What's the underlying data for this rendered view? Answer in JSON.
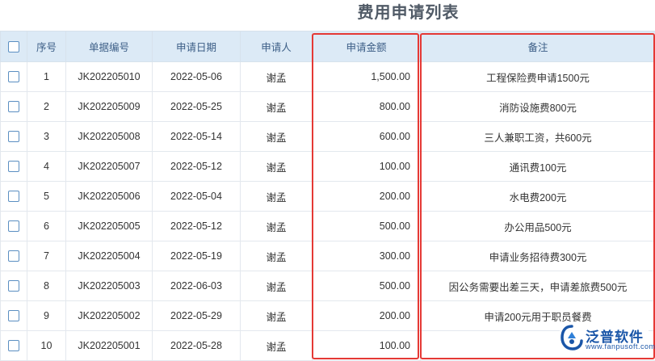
{
  "page": {
    "title": "费用申请列表"
  },
  "table": {
    "columns": [
      "序号",
      "单据编号",
      "申请日期",
      "申请人",
      "申请金额",
      "备注"
    ],
    "rows": [
      {
        "index": "1",
        "code": "JK202205010",
        "date": "2022-05-06",
        "applicant": "谢孟",
        "amount": "1,500.00",
        "remark": "工程保险费申请1500元"
      },
      {
        "index": "2",
        "code": "JK202205009",
        "date": "2022-05-25",
        "applicant": "谢孟",
        "amount": "800.00",
        "remark": "消防设施费800元"
      },
      {
        "index": "3",
        "code": "JK202205008",
        "date": "2022-05-14",
        "applicant": "谢孟",
        "amount": "600.00",
        "remark": "三人兼职工资，共600元"
      },
      {
        "index": "4",
        "code": "JK202205007",
        "date": "2022-05-12",
        "applicant": "谢孟",
        "amount": "100.00",
        "remark": "通讯费100元"
      },
      {
        "index": "5",
        "code": "JK202205006",
        "date": "2022-05-04",
        "applicant": "谢孟",
        "amount": "200.00",
        "remark": "水电费200元"
      },
      {
        "index": "6",
        "code": "JK202205005",
        "date": "2022-05-12",
        "applicant": "谢孟",
        "amount": "500.00",
        "remark": "办公用品500元"
      },
      {
        "index": "7",
        "code": "JK202205004",
        "date": "2022-05-19",
        "applicant": "谢孟",
        "amount": "300.00",
        "remark": "申请业务招待费300元"
      },
      {
        "index": "8",
        "code": "JK202205003",
        "date": "2022-06-03",
        "applicant": "谢孟",
        "amount": "500.00",
        "remark": "因公务需要出差三天，申请差旅费500元"
      },
      {
        "index": "9",
        "code": "JK202205002",
        "date": "2022-05-29",
        "applicant": "谢孟",
        "amount": "200.00",
        "remark": "申请200元用于职员餐费"
      },
      {
        "index": "10",
        "code": "JK202205001",
        "date": "2022-05-28",
        "applicant": "谢孟",
        "amount": "100.00",
        "remark": ""
      }
    ]
  },
  "watermark": {
    "name": "泛普软件",
    "url": "www.fanpusoft.com"
  },
  "colors": {
    "header_bg": "#dceaf6",
    "highlight": "#e53935",
    "brand": "#1a56a8"
  }
}
